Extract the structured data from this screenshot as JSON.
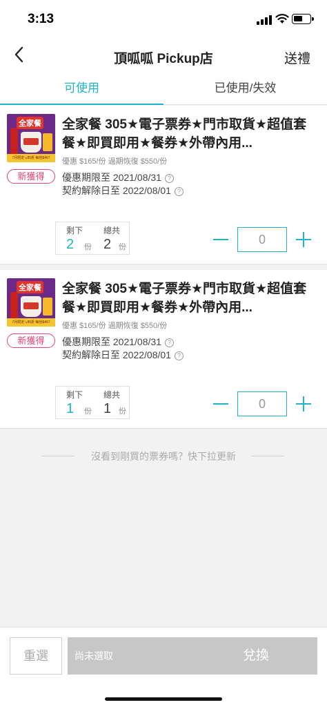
{
  "status_bar": {
    "time": "3:13"
  },
  "nav": {
    "title": "頂呱呱  Pickup店",
    "gift_label": "送禮"
  },
  "tabs": [
    {
      "label": "可使用",
      "active": true
    },
    {
      "label": "已使用/失效",
      "active": false
    }
  ],
  "vouchers": [
    {
      "title": "全家餐 305★電子票券★門市取貨★超值套餐★即買即用★餐券★外帶內用...",
      "image_text": "全家餐",
      "image_caption": "7月限定↘85折 每份$467",
      "badge": "新獲得",
      "price_line": "優惠 $165/份 過期恢復 $550/份",
      "valid_until": "優惠期限至 2021/08/31",
      "contract_end": "契約解除日至 2022/08/01",
      "help_icon": "?",
      "remaining_label": "剩下",
      "remaining": "2",
      "total_label": "總共",
      "total": "2",
      "unit": "份",
      "quantity": "0"
    },
    {
      "title": "全家餐 305★電子票券★門市取貨★超值套餐★即買即用★餐券★外帶內用...",
      "image_text": "全家餐",
      "image_caption": "7月限定↘85折 每份$467",
      "badge": "新獲得",
      "price_line": "優惠 $165/份 過期恢復 $550/份",
      "valid_until": "優惠期限至 2021/08/31",
      "contract_end": "契約解除日至 2022/08/01",
      "help_icon": "?",
      "remaining_label": "剩下",
      "remaining": "1",
      "total_label": "總共",
      "total": "1",
      "unit": "份",
      "quantity": "0"
    }
  ],
  "refresh_hint": "沒看到剛買的票券嗎？快下拉更新",
  "bottom": {
    "reset_label": "重選",
    "selection_hint": "尚未選取",
    "redeem_label": "兌換"
  },
  "colors": {
    "accent": "#1fb4c6",
    "badge": "#e2427b",
    "disabled": "#c7c7c7"
  },
  "icons": [
    "signal-icon",
    "wifi-icon",
    "battery-icon",
    "back-arrow-icon",
    "help-icon",
    "minus-icon",
    "plus-icon"
  ]
}
